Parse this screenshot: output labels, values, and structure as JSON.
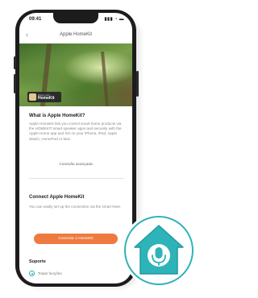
{
  "status_bar": {
    "time": "09:41",
    "icons": "▮▮▮ ◔ ▬"
  },
  "nav": {
    "back_symbol": "‹",
    "title": "Apple HomeKit"
  },
  "hero": {
    "badge_small": "Works with",
    "badge_big": "HomeKit"
  },
  "about": {
    "title": "What is Apple HomeKit?",
    "description": "Apple HomeKit lets you control smart home products via the HOMEKIT smart speaker apps and securely with the Apple Home app and Siri on your iPhone, iPad, Apple Watch, HomePod or Mac.",
    "learn_more_label": "Conexão avançada"
  },
  "connect": {
    "title": "Connect Apple HomeKit",
    "description": "You can easily set up the connection via the smart Nest.",
    "button_label": "Conectar o HomeKit"
  },
  "support": {
    "title": "Suporte",
    "option_label": "Todas funções"
  },
  "overlay": {
    "icon": "homekit-microphone-icon"
  },
  "colors": {
    "accent": "#ee7a40",
    "teal": "#2eb3b8",
    "teal_dark": "#1e9aa3"
  }
}
